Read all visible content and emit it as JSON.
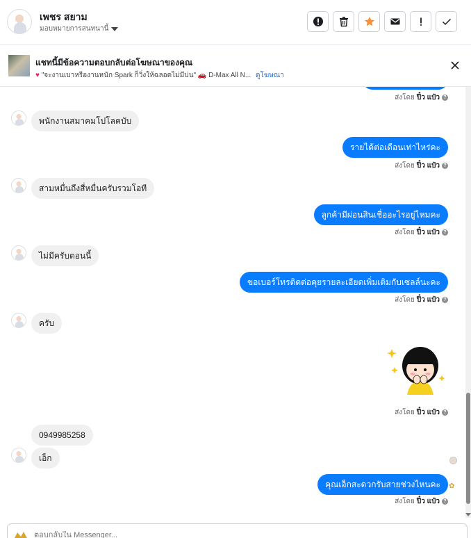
{
  "header": {
    "contact_name": "เพชร สยาม",
    "assign_label": "มอบหมายการสนทนานี้",
    "toolbar": [
      {
        "name": "mark-spam-button",
        "icon": "alert-circle-icon"
      },
      {
        "name": "delete-button",
        "icon": "trash-icon"
      },
      {
        "name": "star-button",
        "icon": "star-icon"
      },
      {
        "name": "mark-unread-button",
        "icon": "envelope-icon"
      },
      {
        "name": "follow-up-button",
        "icon": "exclamation-icon"
      },
      {
        "name": "mark-done-button",
        "icon": "check-icon"
      }
    ],
    "colors": {
      "star": "#f7923b"
    }
  },
  "ad_banner": {
    "title": "แชทนี้มีข้อความตอบกลับต่อโฆษณาของคุณ",
    "subtitle": "\"จะงานเบาหรืองานหนัก Spark ก็วิ่งให้ฉลอดไม่มีบ่น\" 🚗 D-Max All N...",
    "link_label": "ดูโฆษณา"
  },
  "conversation": {
    "sent_by_prefix": "ส่งโดย",
    "sent_by_name": "ปิ๋ว แป๋ว",
    "messages": [
      {
        "from": "them",
        "text": "พนักงานสมาคมโปโลคบับ"
      },
      {
        "from": "me",
        "text": "รายได้ต่อเดือนเท่าไหร่คะ"
      },
      {
        "from": "them",
        "text": "สามหมื่นถึงสี่หมื่นครับรวมโอที"
      },
      {
        "from": "me",
        "text": "ลูกค้ามีผ่อนสินเชื่ออะไรอยู่ไหมคะ"
      },
      {
        "from": "them",
        "text": "ไม่มีครับตอนนี้"
      },
      {
        "from": "me",
        "text": "ขอเบอร์โทรติดต่อคุยรายละเอียดเพิ่มเติมกับเซลล์นะคะ"
      },
      {
        "from": "them",
        "text": "ครับ"
      },
      {
        "from": "me",
        "type": "sticker",
        "text": ""
      },
      {
        "from": "them",
        "text": "0949985258"
      },
      {
        "from": "them",
        "text": "เอ็ก"
      },
      {
        "from": "me",
        "text": "คุณเอ็กสะดวกรับสายช่วงไหนคะ"
      }
    ],
    "colors": {
      "outgoing_bubble": "#0a7cff",
      "incoming_bubble": "#f0f0f0"
    }
  },
  "composer": {
    "placeholder": "ตอบกลับใน Messenger..."
  }
}
